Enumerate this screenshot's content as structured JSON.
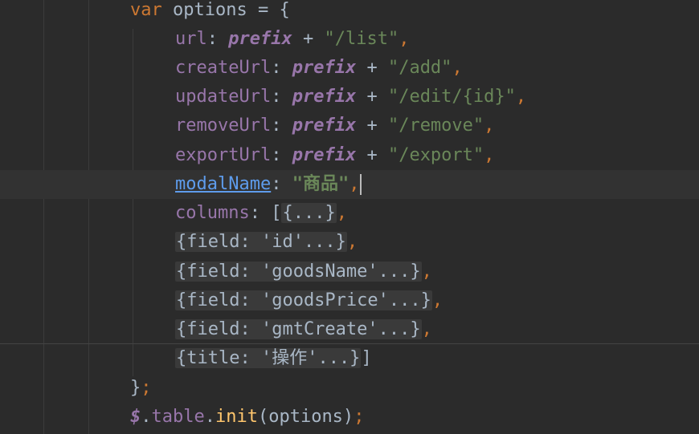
{
  "code": {
    "l1": {
      "kw": "var",
      "name": "options",
      "op": "=",
      "brace": "{"
    },
    "url": {
      "key": "url",
      "colon": ":",
      "prefix": "prefix",
      "plus": "+",
      "value": "\"/list\"",
      "comma": ","
    },
    "create": {
      "key": "createUrl",
      "colon": ":",
      "prefix": "prefix",
      "plus": "+",
      "value": "\"/add\"",
      "comma": ","
    },
    "update": {
      "key": "updateUrl",
      "colon": ":",
      "prefix": "prefix",
      "plus": "+",
      "value": "\"/edit/{id}\"",
      "comma": ","
    },
    "remove": {
      "key": "removeUrl",
      "colon": ":",
      "prefix": "prefix",
      "plus": "+",
      "value": "\"/remove\"",
      "comma": ","
    },
    "export": {
      "key": "exportUrl",
      "colon": ":",
      "prefix": "prefix",
      "plus": "+",
      "value": "\"/export\"",
      "comma": ","
    },
    "modal": {
      "key": "modalName",
      "colon": ":",
      "value": "\"商品\"",
      "comma": ","
    },
    "columns": {
      "key": "columns",
      "colon": ":",
      "bracket": "[",
      "fold": "{...}",
      "comma": ","
    },
    "col_id": {
      "fold": "{field: 'id'...}",
      "comma": ","
    },
    "col_name": {
      "fold": "{field: 'goodsName'...}",
      "comma": ","
    },
    "col_price": {
      "fold": "{field: 'goodsPrice'...}",
      "comma": ","
    },
    "col_gmt": {
      "fold": "{field: 'gmtCreate'...}",
      "comma": ","
    },
    "col_title": {
      "fold": "{title: '操作'...}",
      "bracket": "]"
    },
    "close": {
      "brace": "}",
      "semi": ";"
    },
    "call": {
      "dollar": "$",
      "dot1": ".",
      "table": "table",
      "dot2": ".",
      "fn": "init",
      "args": "(options)",
      "semi": ";"
    }
  }
}
